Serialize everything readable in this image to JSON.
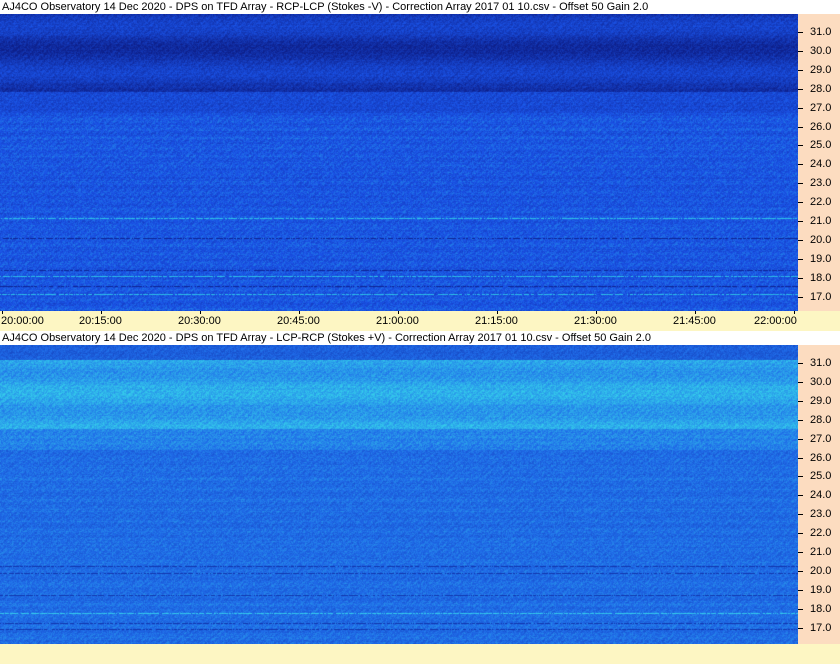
{
  "panels": [
    {
      "title": "AJ4CO Observatory 14 Dec 2020  -  DPS on TFD Array  -  RCP-LCP (Stokes -V)  -  Correction Array 2017 01 10.csv  -  Offset 50  Gain 2.0",
      "colors": {
        "base": "#1a52e6",
        "dark_band": "#0d1f8a",
        "bright_band": "#2ec8e8"
      }
    },
    {
      "title": "AJ4CO Observatory 14 Dec 2020  -  DPS on TFD Array  -  LCP-RCP (Stokes +V)  -  Correction Array 2017 01 10.csv  -  Offset 50  Gain 2.0",
      "colors": {
        "base": "#1f6ae8",
        "dark_band": "#1030a8",
        "bright_band": "#35d0ec"
      }
    }
  ],
  "freq_labels": [
    "31.0",
    "30.0",
    "29.0",
    "28.0",
    "27.0",
    "26.0",
    "25.0",
    "24.0",
    "23.0",
    "22.0",
    "21.0",
    "20.0",
    "19.0",
    "18.0",
    "17.0"
  ],
  "time_labels": [
    "20:00:00",
    "20:15:00",
    "20:30:00",
    "20:45:00",
    "21:00:00",
    "21:15:00",
    "21:30:00",
    "21:45:00",
    "22:00:00"
  ],
  "colors": {
    "axis_bg": "#fcdcc0",
    "time_axis_bg": "#fdf6c3"
  }
}
